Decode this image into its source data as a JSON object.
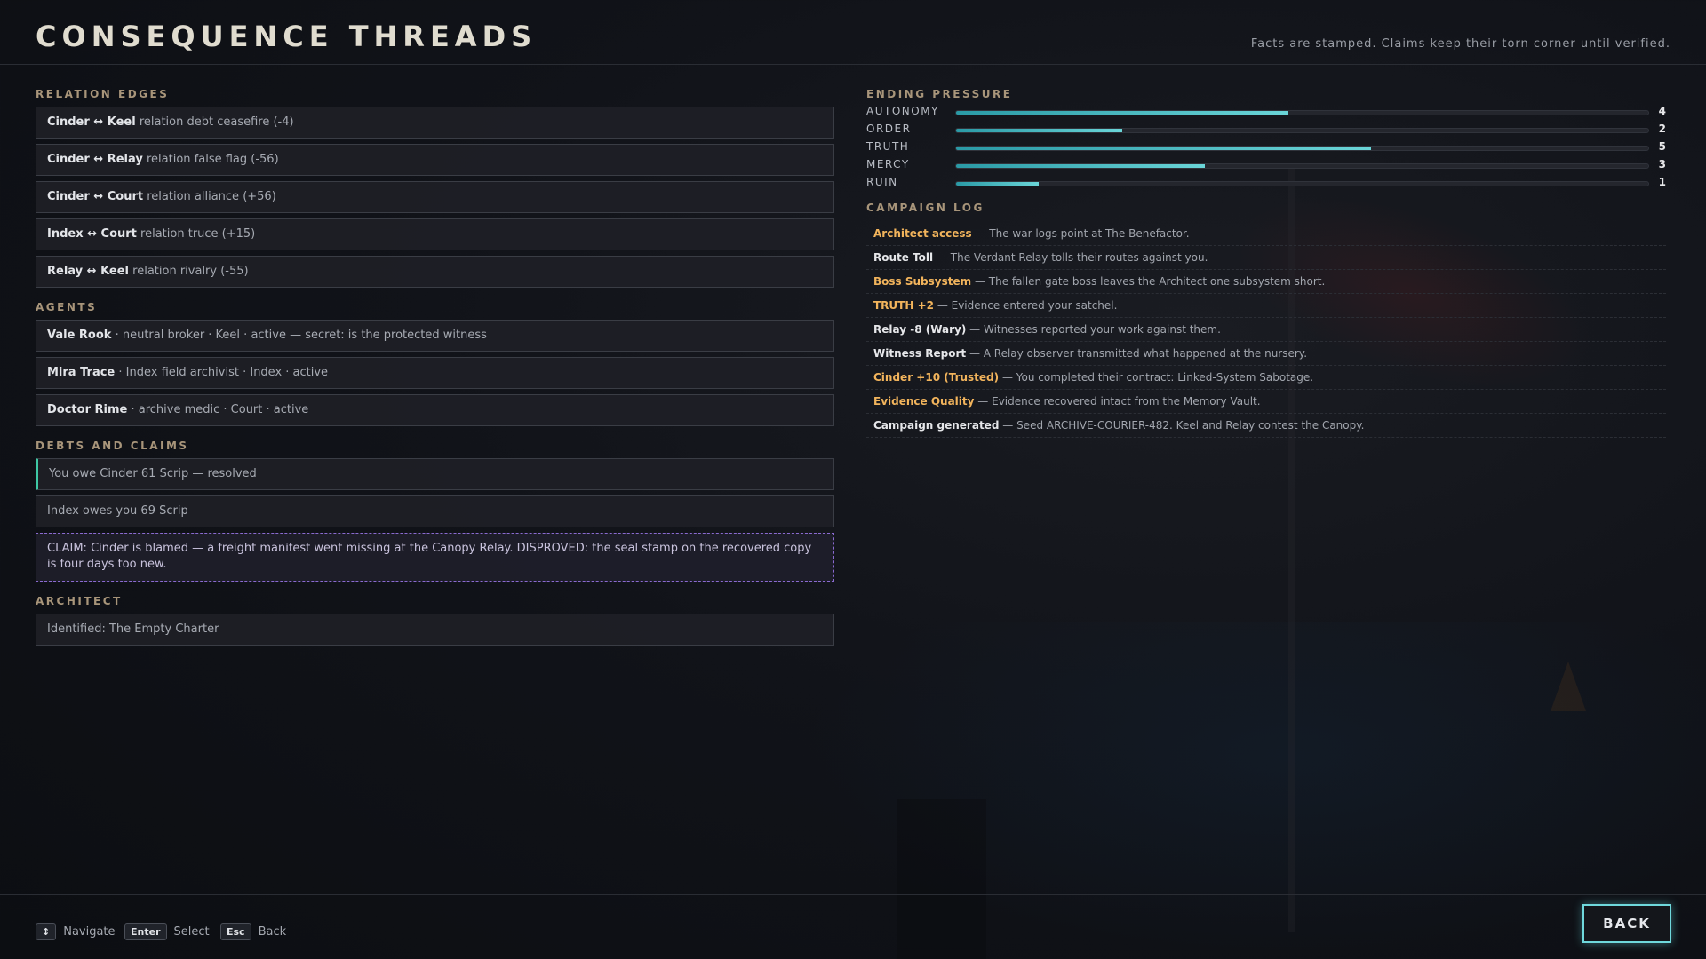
{
  "header": {
    "title": "CONSEQUENCE THREADS",
    "subtitle": "Facts are stamped. Claims keep their torn corner until verified."
  },
  "relation_edges": {
    "label": "RELATION EDGES",
    "items": [
      {
        "pair": "Cinder ↔ Keel",
        "detail": "relation debt ceasefire (-4)"
      },
      {
        "pair": "Cinder ↔ Relay",
        "detail": "relation false flag (-56)"
      },
      {
        "pair": "Cinder ↔ Court",
        "detail": "relation alliance (+56)"
      },
      {
        "pair": "Index ↔ Court",
        "detail": "relation truce (+15)"
      },
      {
        "pair": "Relay ↔ Keel",
        "detail": "relation rivalry (-55)"
      }
    ]
  },
  "agents": {
    "label": "AGENTS",
    "items": [
      {
        "name": "Vale Rook",
        "detail": "· neutral broker · Keel · active — secret: is the protected witness"
      },
      {
        "name": "Mira Trace",
        "detail": "· Index field archivist · Index · active"
      },
      {
        "name": "Doctor Rime",
        "detail": "· archive medic · Court · active"
      }
    ]
  },
  "debts": {
    "label": "DEBTS AND CLAIMS",
    "resolved": "You owe Cinder 61 Scrip — resolved",
    "owed": "Index owes you 69 Scrip",
    "claim": "CLAIM: Cinder is blamed — a freight manifest went missing at the Canopy Relay. DISPROVED: the seal stamp on the recovered copy is four days too new."
  },
  "architect": {
    "label": "ARCHITECT",
    "value": "Identified: The Empty Charter"
  },
  "ending_pressure": {
    "label": "ENDING PRESSURE",
    "max": 10,
    "items": [
      {
        "name": "AUTONOMY",
        "value": 4,
        "fill": 0.48
      },
      {
        "name": "ORDER",
        "value": 2,
        "fill": 0.24
      },
      {
        "name": "TRUTH",
        "value": 5,
        "fill": 0.6
      },
      {
        "name": "MERCY",
        "value": 3,
        "fill": 0.36
      },
      {
        "name": "RUIN",
        "value": 1,
        "fill": 0.12
      }
    ]
  },
  "campaign_log": {
    "label": "CAMPAIGN LOG",
    "highlight_color": "#f2b45c",
    "items": [
      {
        "key": "Architect access",
        "text": "— The war logs point at The Benefactor.",
        "highlight": true
      },
      {
        "key": "Route Toll",
        "text": "— The Verdant Relay tolls their routes against you.",
        "highlight": false
      },
      {
        "key": "Boss Subsystem",
        "text": "— The fallen gate boss leaves the Architect one subsystem short.",
        "highlight": true
      },
      {
        "key": "TRUTH +2",
        "text": "— Evidence entered your satchel.",
        "highlight": true
      },
      {
        "key": "Relay -8 (Wary)",
        "text": "— Witnesses reported your work against them.",
        "highlight": false
      },
      {
        "key": "Witness Report",
        "text": "— A Relay observer transmitted what happened at the nursery.",
        "highlight": false
      },
      {
        "key": "Cinder +10 (Trusted)",
        "text": "— You completed their contract: Linked-System Sabotage.",
        "highlight": true
      },
      {
        "key": "Evidence Quality",
        "text": "— Evidence recovered intact from the Memory Vault.",
        "highlight": true
      },
      {
        "key": "Campaign generated",
        "text": "— Seed ARCHIVE-COURIER-482. Keel and Relay contest the Canopy.",
        "highlight": false
      }
    ]
  },
  "footer": {
    "navigate_key": "↕",
    "navigate_label": "Navigate",
    "select_key": "Enter",
    "select_label": "Select",
    "back_key": "Esc",
    "back_label": "Back",
    "back_button": "BACK"
  },
  "colors": {
    "accent": "#6fd8dc",
    "section_label": "#a8957a",
    "resolved": "#3ec7a4",
    "claim_border": "#8a6ad0"
  }
}
